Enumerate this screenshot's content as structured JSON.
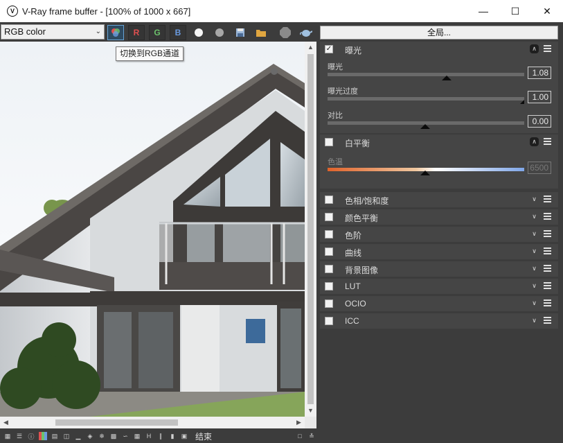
{
  "window": {
    "title": "V-Ray frame buffer - [100% of 1000 x 667]",
    "controls": [
      "—",
      "☐",
      "✕"
    ]
  },
  "toolbar": {
    "channel_select": "RGB color",
    "channel_r": "R",
    "channel_g": "G",
    "channel_b": "B",
    "globals_button": "全局...",
    "tooltip": "切换到RGB通道"
  },
  "rollouts": [
    {
      "title": "曝光",
      "checked": true,
      "expanded": true,
      "params": [
        {
          "label": "曝光",
          "value": "1.08",
          "position": 0.61
        },
        {
          "label": "曝光过度",
          "value": "1.00",
          "position": 1.0
        },
        {
          "label": "对比",
          "value": "0.00",
          "position": 0.5
        }
      ]
    },
    {
      "title": "白平衡",
      "checked": false,
      "expanded": true,
      "params": [
        {
          "label": "色温",
          "value": "6500",
          "position": 0.5
        }
      ]
    },
    {
      "title": "色相/饱和度",
      "checked": false,
      "expanded": false
    },
    {
      "title": "颜色平衡",
      "checked": false,
      "expanded": false
    },
    {
      "title": "色阶",
      "checked": false,
      "expanded": false
    },
    {
      "title": "曲线",
      "checked": false,
      "expanded": false
    },
    {
      "title": "背景图像",
      "checked": false,
      "expanded": false
    },
    {
      "title": "LUT",
      "checked": false,
      "expanded": false
    },
    {
      "title": "OCIO",
      "checked": false,
      "expanded": false
    },
    {
      "title": "ICC",
      "checked": false,
      "expanded": false
    }
  ],
  "statusbar": {
    "text": "结束"
  },
  "colors": {
    "background": "#3c3c3c",
    "panel": "#454545",
    "channel_r": "#e05050",
    "channel_g": "#6cc26c",
    "channel_b": "#6a9be0",
    "active_border": "#67a4d6"
  }
}
